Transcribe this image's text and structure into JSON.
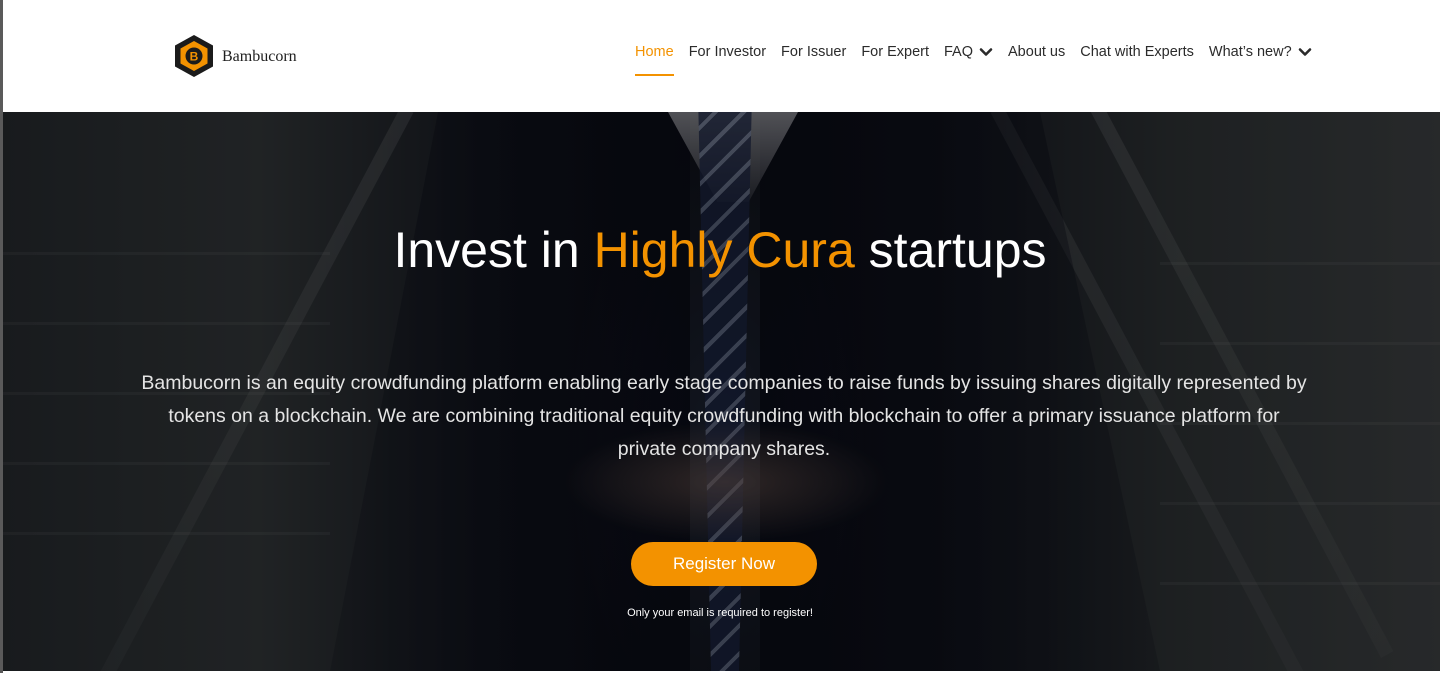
{
  "brand": {
    "name": "Bambucorn",
    "accent_color": "#f39200"
  },
  "nav": {
    "items": [
      {
        "label": "Home",
        "active": true,
        "dropdown": false
      },
      {
        "label": "For Investor",
        "active": false,
        "dropdown": false
      },
      {
        "label": "For Issuer",
        "active": false,
        "dropdown": false
      },
      {
        "label": "For Expert",
        "active": false,
        "dropdown": false
      },
      {
        "label": "FAQ",
        "active": false,
        "dropdown": true
      },
      {
        "label": "About us",
        "active": false,
        "dropdown": false
      },
      {
        "label": "Chat with Experts",
        "active": false,
        "dropdown": false
      },
      {
        "label": "What’s new?",
        "active": false,
        "dropdown": true
      }
    ]
  },
  "hero": {
    "headline_pre": "Invest in ",
    "headline_accent": "Highly Cura",
    "headline_post": " startups",
    "description": "Bambucorn is an equity crowdfunding platform enabling early stage companies to raise funds by issuing shares digitally represented by tokens on a blockchain. We are combining traditional equity crowdfunding with blockchain to offer a primary issuance platform for private company shares.",
    "cta_label": "Register Now",
    "cta_note": "Only your email is required to register!"
  },
  "icons": {
    "logo": "bambucorn-hexagon-logo-icon",
    "dropdown": "chevron-down-icon"
  }
}
